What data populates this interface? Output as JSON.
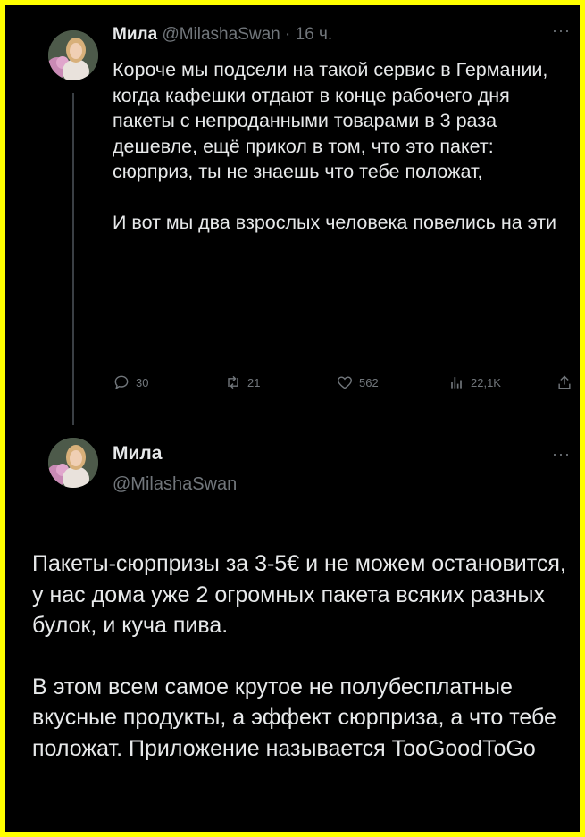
{
  "tweet1": {
    "name": "Мила",
    "handle": "@MilashaSwan",
    "separator": "·",
    "time": "16 ч.",
    "paragraphs": [
      "Короче мы подсели на такой сервис в Германии, когда кафешки отдают в конце рабочего дня пакеты с непроданными товарами в 3 раза дешевле, ещё прикол в том, что это пакет: сюрприз, ты не знаешь что тебе положат,",
      "И вот мы два взрослых человека повелись на эти"
    ],
    "actions": {
      "replies": "30",
      "retweets": "21",
      "likes": "562",
      "views": "22,1K"
    }
  },
  "tweet2": {
    "name": "Мила",
    "handle": "@MilashaSwan",
    "paragraphs": [
      "Пакеты-сюрпризы за 3-5€ и не можем остановится, у нас дома уже 2 огромных пакета всяких разных булок, и куча пива.",
      "В этом всем самое крутое не полубесплатные вкусные продукты, а эффект сюрприза, а что тебе положат. Приложение называется TooGoodToGo"
    ]
  },
  "colors": {
    "frame": "#ffff00",
    "background": "#000000",
    "text": "#e7e9ea",
    "muted": "#71767b"
  }
}
